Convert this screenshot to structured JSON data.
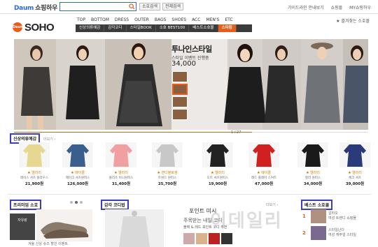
{
  "topbar": {
    "brand": "Daum",
    "service": "쇼핑하우",
    "search_placeholder": "",
    "btn_soho": "소호검색",
    "btn_detail": "전체검색",
    "links": [
      "가이드라인 안내보기",
      "쇼핑몰",
      "MY쇼핑하우"
    ]
  },
  "header": {
    "logo_badge": "Daum",
    "logo_word": "SOHO",
    "categories": [
      "TOP",
      "BOTTOM",
      "DRESS",
      "OUTER",
      "BAGS",
      "SHOES",
      "ACC",
      "MEN'S",
      "ETC"
    ],
    "favorite": "★ 즐겨찾는 소호몰",
    "nav": [
      "신상의류예감",
      "감각코디",
      "스타일BOOK",
      "소호 BEST100",
      "베스트소호몰",
      "스타킹"
    ],
    "nav_active_index": 5
  },
  "banner": {
    "headline": "투나인스타일",
    "sub": "스타일 이벤트 진행중",
    "price": "34,000",
    "pager": "1 / 27"
  },
  "new_arrivals": {
    "title": "신상의류예감",
    "more": "더보기 ›",
    "items": [
      {
        "shop": "♠ 엘라리",
        "name": "레이스 셔츠 블라우스",
        "price": "21,900원",
        "color": "#e6d890"
      },
      {
        "shop": "♠ 메이클",
        "name": "제이크 셔츠원피스",
        "price": "126,000원",
        "color": "#3a5f8f"
      },
      {
        "shop": "♠ 엘라리",
        "name": "플리츠 미니원피스",
        "price": "31,400원",
        "color": "#f0a0a0"
      },
      {
        "shop": "♠ 캔디블로썸",
        "name": "트위드 원피스",
        "price": "25,700원",
        "color": "#c8c8c8"
      },
      {
        "shop": "♠ 엘라리",
        "name": "도트 셔츠원피스",
        "price": "19,900원",
        "color": "#222222"
      },
      {
        "shop": "♠ 메이클",
        "name": "레드 플레어 스커트",
        "price": "47,000원",
        "color": "#d02020"
      },
      {
        "shop": "♠ 엘라리",
        "name": "칼라 원피스",
        "price": "34,000원",
        "color": "#1a1a1a"
      },
      {
        "shop": "♠ 엘라리",
        "name": "체크 셔츠",
        "price": "39,000원",
        "color": "#2a3a7a"
      }
    ]
  },
  "premium": {
    "title": "프리미엄 소호",
    "dark_label": "자유랑",
    "caption": "겨울 신상 슈즈 할인 이벤트"
  },
  "coordi": {
    "title": "감각 코디법",
    "more": "더보기 ›",
    "headline": "포인트 미시",
    "text": "주목받는 내일 코디",
    "small": "블랙 & 레드 포인트 코디 추천",
    "watermark": "이데일리"
  },
  "best_shops": {
    "title": "베스트 소호몰",
    "items": [
      {
        "rank": "1",
        "line1": "갈라오",
        "line2": "여성 트렌디 쇼핑몰"
      },
      {
        "rank": "2",
        "line1": "스타일난다",
        "line2": "여성 캐주얼 스타일"
      }
    ]
  }
}
